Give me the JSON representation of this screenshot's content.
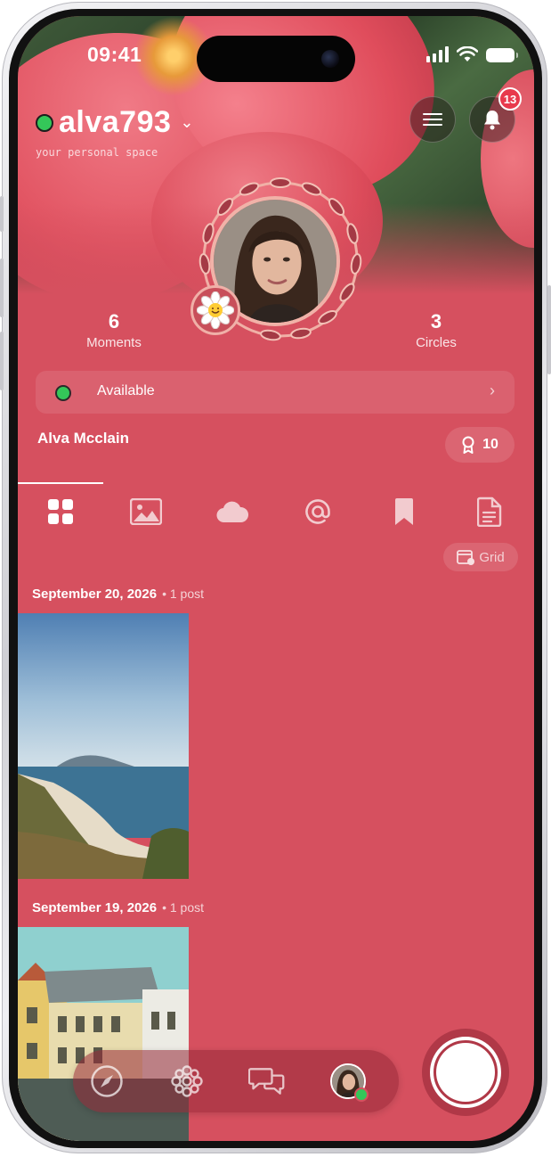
{
  "status_bar": {
    "time": "09:41"
  },
  "profile": {
    "username": "alva793",
    "tagline": "your personal space",
    "full_name": "Alva Mcclain",
    "notifications_count": "13",
    "stats": [
      {
        "value": "6",
        "label": "Moments"
      },
      {
        "value": "3",
        "label": "Circles"
      }
    ],
    "availability": "Available",
    "award_count": "10"
  },
  "tabs": [
    {
      "icon": "grid-icon",
      "active": true
    },
    {
      "icon": "image-icon",
      "active": false
    },
    {
      "icon": "cloud-icon",
      "active": false
    },
    {
      "icon": "at-icon",
      "active": false
    },
    {
      "icon": "bookmark-icon",
      "active": false
    },
    {
      "icon": "document-icon",
      "active": false
    }
  ],
  "view_toggle": {
    "label": "Grid"
  },
  "feed": [
    {
      "date": "September 20, 2026",
      "count": "• 1 post"
    },
    {
      "date": "September 19, 2026",
      "count": "• 1 post"
    }
  ],
  "bottom_nav": [
    "compass-icon",
    "flower-icon",
    "chat-bubbles-icon",
    "profile-avatar"
  ],
  "colors": {
    "background": "#d6505f",
    "online": "#34c759",
    "badge": "#e8394c"
  }
}
